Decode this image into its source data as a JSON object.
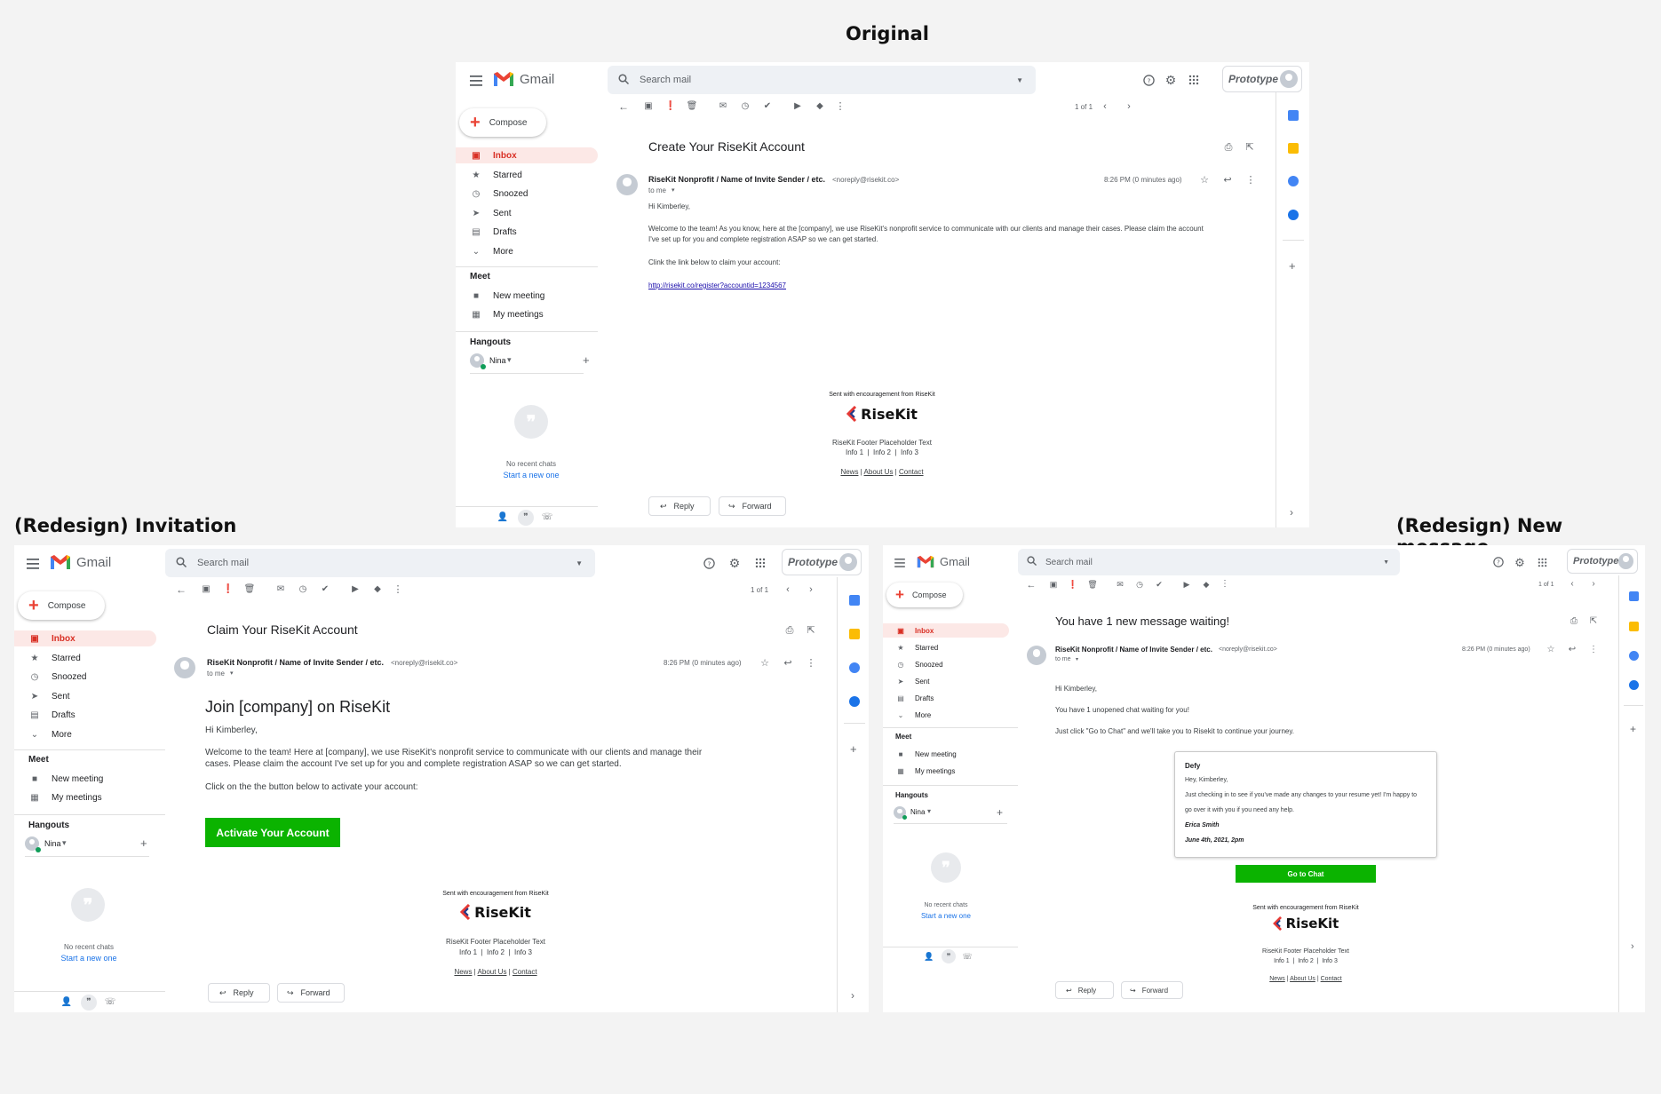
{
  "titles": {
    "original": "Original",
    "invitation": "(Redesign) Invitation",
    "newmessage": "(Redesign) New message"
  },
  "gmail": {
    "app_name": "Gmail",
    "search_placeholder": "Search mail",
    "prototype_label": "Prototype",
    "compose": "Compose",
    "nav": [
      "Inbox",
      "Starred",
      "Snoozed",
      "Sent",
      "Drafts",
      "More"
    ],
    "meet_heading": "Meet",
    "meet_items": [
      "New meeting",
      "My meetings"
    ],
    "hangouts_heading": "Hangouts",
    "hangouts_user": "Nina",
    "no_recent_chats": "No recent chats",
    "start_new": "Start a new one",
    "pager": "1 of 1",
    "sender": "RiseKit Nonprofit / Name of Invite Sender / etc.",
    "sender_email": "<noreply@risekit.co>",
    "to_me": "to me",
    "time": "8:26 PM (0 minutes ago)",
    "reply": "Reply",
    "forward": "Forward"
  },
  "footer": {
    "sent_with": "Sent with encouragement from RiseKit",
    "brand": "RiseKit",
    "placeholder": "RiseKit Footer Placeholder Text",
    "info": "Info 1  |  Info 2  |  Info 3",
    "links": [
      "News",
      "About Us",
      "Contact"
    ]
  },
  "original": {
    "subject": "Create Your RiseKit Account",
    "greeting": "Hi Kimberley,",
    "body1": "Welcome to the team! As you know, here at the [company], we use RiseKit's nonprofit service to communicate with our clients and manage their cases. Please claim the account",
    "body2": "I've set up for you and complete registration ASAP so we can get started.",
    "body3": "Clink the link below to claim your account:",
    "link": "http://risekit.co/register?accountid=1234567"
  },
  "invitation": {
    "subject": "Claim Your RiseKit Account",
    "heading": "Join [company] on RiseKit",
    "greeting": "Hi Kimberley,",
    "body1": "Welcome to the team! Here at [company], we use RiseKit's nonprofit service to communicate with our clients and manage their",
    "body2": "cases. Please claim the account I've set up for you and complete registration ASAP so we can get started.",
    "body3": "Click on the the button below to activate your account:",
    "button": "Activate Your Account"
  },
  "newmessage": {
    "subject": "You have 1 new message waiting!",
    "greeting": "Hi Kimberley,",
    "body1": "You have 1 unopened chat waiting for you!",
    "body2": "Just click \"Go to Chat\" and we'll take you to Risekit to continue your journey.",
    "card_sender": "Defy",
    "card_greeting": "Hey, Kimberley,",
    "card_line1": "Just checking in to see if you've made any changes to your resume yet! I'm happy to",
    "card_line2": "go over it with you if you need any help.",
    "card_sign": "Erica Smith",
    "card_date": "June 4th, 2021, 2pm",
    "button": "Go to Chat"
  },
  "colors": {
    "green_button": "#0bb300",
    "inbox_active": "#d93025",
    "link": "#1a0dab"
  }
}
